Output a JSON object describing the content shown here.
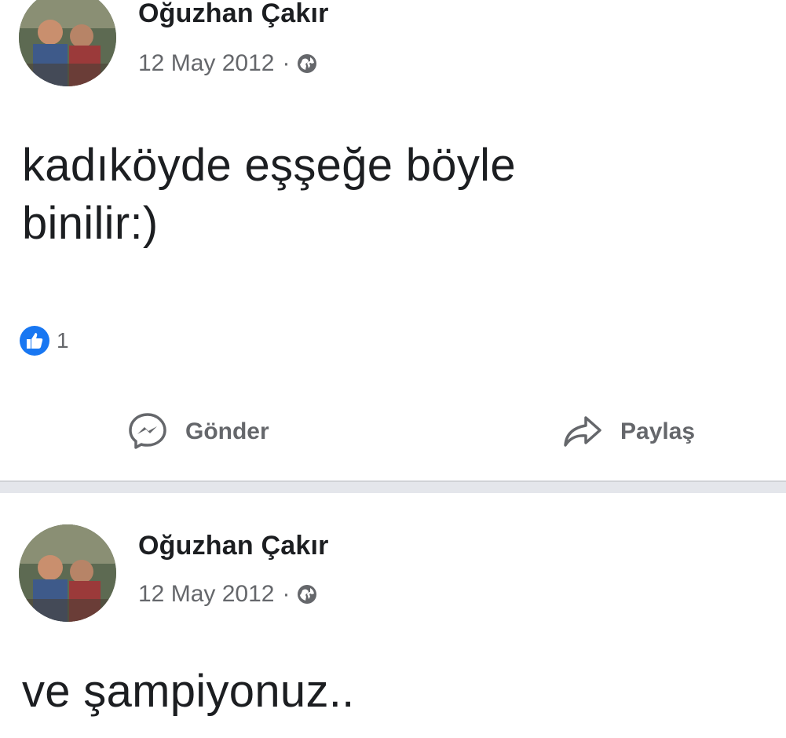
{
  "posts": [
    {
      "author": "Oğuzhan Çakır",
      "date": "12 May 2012",
      "separator": "·",
      "privacy_icon": "globe-icon",
      "text_line1": "kadıköyde eşşeğe böyle",
      "text_line2": "binilir:)",
      "reaction_icon": "like-icon",
      "reaction_count": "1",
      "actions": {
        "send_label": "Gönder",
        "send_icon": "messenger-icon",
        "share_label": "Paylaş",
        "share_icon": "share-arrow-icon"
      }
    },
    {
      "author": "Oğuzhan Çakır",
      "date": "12 May 2012",
      "separator": "·",
      "privacy_icon": "globe-icon",
      "text_line1": "ve şampiyonuz.."
    }
  ],
  "colors": {
    "text_primary": "#1c1e21",
    "text_secondary": "#65676b",
    "like_blue": "#1877f2",
    "divider": "#e4e6eb"
  }
}
